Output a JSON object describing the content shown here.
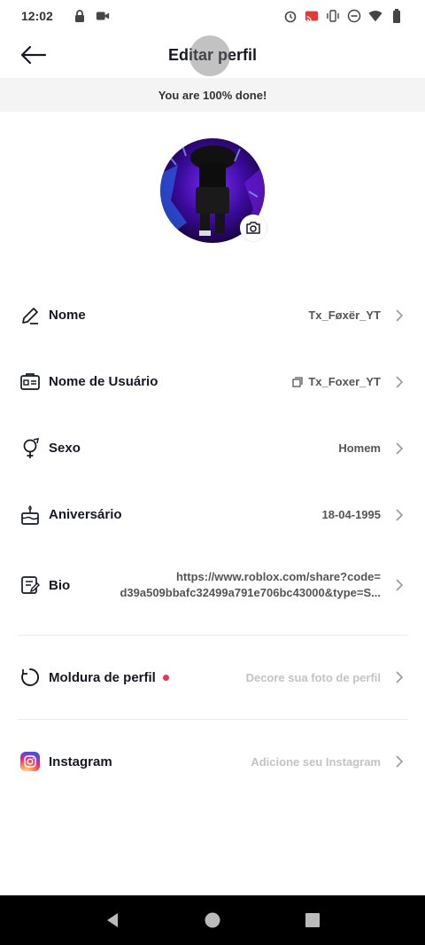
{
  "status_bar": {
    "time": "12:02",
    "left_icons": [
      "lock-icon",
      "video-icon"
    ],
    "right_icons": [
      "alarm-icon",
      "cast-icon",
      "vibrate-icon",
      "dnd-icon",
      "wifi-icon",
      "battery-icon"
    ]
  },
  "header": {
    "title": "Editar perfil",
    "back_icon": "arrow-left-icon"
  },
  "progress": {
    "text": "You are 100% done!"
  },
  "avatar": {
    "camera_icon": "camera-icon"
  },
  "rows": {
    "nome": {
      "label": "Nome",
      "value": "Tx_Føxër_YT",
      "icon": "pencil-icon"
    },
    "usuario": {
      "label": "Nome de Usuário",
      "value": "Tx_Foxer_YT",
      "icon": "id-card-icon"
    },
    "sexo": {
      "label": "Sexo",
      "value": "Homem",
      "icon": "gender-icon"
    },
    "aniversario": {
      "label": "Aniversário",
      "value": "18-04-1995",
      "icon": "cake-icon"
    },
    "bio": {
      "label": "Bio",
      "value_line1": "https://www.roblox.com/share?code=",
      "value_line2": "d39a509bbafc32499a791e706bc43000&type=S...",
      "icon": "bio-edit-icon"
    },
    "moldura": {
      "label": "Moldura de perfil",
      "value": "Decore sua foto de perfil",
      "icon": "frame-ring-icon"
    },
    "instagram": {
      "label": "Instagram",
      "value": "Adicione seu Instagram",
      "icon": "instagram-icon"
    }
  },
  "colors": {
    "accent_red": "#fe2c55",
    "banner_bg": "#f4f4f5"
  },
  "nav_bar": {
    "buttons": [
      "back-triangle-icon",
      "home-circle-icon",
      "recents-square-icon"
    ]
  }
}
